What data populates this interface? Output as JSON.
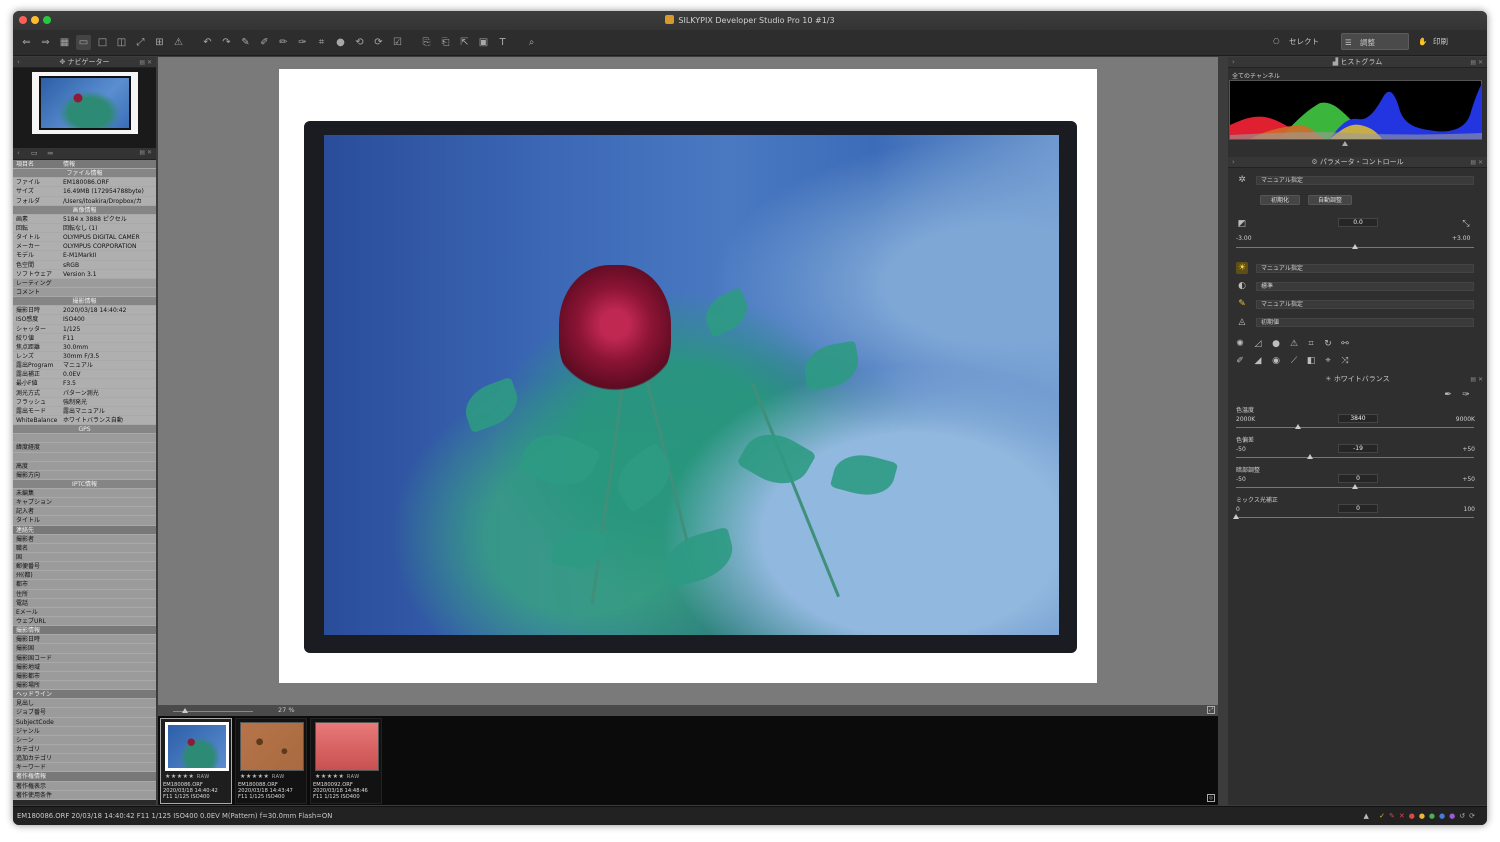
{
  "window": {
    "title": "SILKYPIX Developer Studio Pro 10   #1/3"
  },
  "toolbar": {
    "modes": [
      {
        "label": "セレクト",
        "icon": "select-mode-icon"
      },
      {
        "label": "調整",
        "icon": "adjust-mode-icon",
        "active": true
      },
      {
        "label": "印刷",
        "icon": "print-mode-icon"
      }
    ]
  },
  "navigator": {
    "title": "ナビゲーター"
  },
  "info": {
    "col_key": "項目名",
    "col_val": "情報",
    "rows": [
      {
        "type": "s",
        "k": "",
        "v": "ファイル情報"
      },
      {
        "k": "ファイル",
        "v": "EM180086.ORF"
      },
      {
        "k": "サイズ",
        "v": "16.49MB (172954788byte)"
      },
      {
        "k": "フォルダ",
        "v": "/Users/itoakira/Dropbox/カ"
      },
      {
        "type": "s",
        "k": "",
        "v": "画像情報"
      },
      {
        "k": "画素",
        "v": "5184 x 3888 ピクセル"
      },
      {
        "k": "回転",
        "v": "回転なし (1)"
      },
      {
        "k": "タイトル",
        "v": "OLYMPUS DIGITAL CAMER"
      },
      {
        "k": "メーカー",
        "v": "OLYMPUS CORPORATION"
      },
      {
        "k": "モデル",
        "v": "E-M1MarkII"
      },
      {
        "k": "色空間",
        "v": "sRGB"
      },
      {
        "k": "ソフトウェア",
        "v": "Version 3.1"
      },
      {
        "k": "レーティング",
        "v": ""
      },
      {
        "k": "コメント",
        "v": ""
      },
      {
        "type": "s",
        "k": "",
        "v": "撮影情報"
      },
      {
        "k": "撮影日時",
        "v": "2020/03/18 14:40:42"
      },
      {
        "k": "ISO感度",
        "v": "ISO400"
      },
      {
        "k": "シャッター",
        "v": "1/125"
      },
      {
        "k": "絞り値",
        "v": "F11"
      },
      {
        "k": "焦点距離",
        "v": "30.0mm"
      },
      {
        "k": "レンズ",
        "v": "30mm F/3.5"
      },
      {
        "k": "露出Program",
        "v": "マニュアル"
      },
      {
        "k": "露出補正",
        "v": "0.0EV"
      },
      {
        "k": "最小F値",
        "v": "F3.5"
      },
      {
        "k": "測光方式",
        "v": "パターン測光"
      },
      {
        "k": "フラッシュ",
        "v": "強制発光"
      },
      {
        "k": "露出モード",
        "v": "露出マニュアル"
      },
      {
        "k": "WhiteBalance",
        "v": "ホワイトバランス自動"
      },
      {
        "type": "s",
        "k": "",
        "v": "GPS"
      },
      {
        "k": "",
        "v": ""
      },
      {
        "k": "緯度経度",
        "v": ""
      },
      {
        "k": "",
        "v": ""
      },
      {
        "k": "高度",
        "v": ""
      },
      {
        "k": "撮影方向",
        "v": ""
      },
      {
        "type": "s",
        "k": "",
        "v": "IPTC情報"
      },
      {
        "k": "未編集",
        "v": ""
      },
      {
        "k": "キャプション",
        "v": ""
      },
      {
        "k": "記入者",
        "v": ""
      },
      {
        "k": "タイトル",
        "v": ""
      },
      {
        "type": "h",
        "k": "連絡先",
        "v": ""
      },
      {
        "k": "撮影者",
        "v": ""
      },
      {
        "k": "職名",
        "v": ""
      },
      {
        "k": "国",
        "v": ""
      },
      {
        "k": "郵便番号",
        "v": ""
      },
      {
        "k": "州(都)",
        "v": ""
      },
      {
        "k": "都市",
        "v": ""
      },
      {
        "k": "住所",
        "v": ""
      },
      {
        "k": "電話",
        "v": ""
      },
      {
        "k": "Eメール",
        "v": ""
      },
      {
        "k": "ウェブURL",
        "v": ""
      },
      {
        "type": "h",
        "k": "撮影情報",
        "v": ""
      },
      {
        "k": "撮影日時",
        "v": ""
      },
      {
        "k": "撮影国",
        "v": ""
      },
      {
        "k": "撮影国コード",
        "v": ""
      },
      {
        "k": "撮影地域",
        "v": ""
      },
      {
        "k": "撮影都市",
        "v": ""
      },
      {
        "k": "撮影場所",
        "v": ""
      },
      {
        "type": "h",
        "k": "ヘッドライン",
        "v": ""
      },
      {
        "k": "見出し",
        "v": ""
      },
      {
        "k": "ジョブ番号",
        "v": ""
      },
      {
        "k": "SubjectCode",
        "v": ""
      },
      {
        "k": "ジャンル",
        "v": ""
      },
      {
        "k": "シーン",
        "v": ""
      },
      {
        "k": "カテゴリ",
        "v": ""
      },
      {
        "k": "追加カテゴリ",
        "v": ""
      },
      {
        "k": "キーワード",
        "v": ""
      },
      {
        "type": "h",
        "k": "著作権情報",
        "v": ""
      },
      {
        "k": "著作権表示",
        "v": ""
      },
      {
        "k": "著作使用条件",
        "v": ""
      }
    ]
  },
  "viewer": {
    "zoom": "27 %"
  },
  "filmstrip": [
    {
      "name": "EM180086.ORF",
      "date": "2020/03/18 14:40:42",
      "exif": "F11 1/125 ISO400",
      "stars": "★★★★★",
      "raw": "RAW",
      "selected": true,
      "color": "blue"
    },
    {
      "name": "EM180088.ORF",
      "date": "2020/03/18 14:43:47",
      "exif": "F11 1/125 ISO400",
      "stars": "★★★★★",
      "raw": "RAW",
      "selected": false,
      "color": "brown"
    },
    {
      "name": "EM180092.ORF",
      "date": "2020/03/18 14:48:46",
      "exif": "F11 1/125 ISO400",
      "stars": "★★★★★",
      "raw": "RAW",
      "selected": false,
      "color": "pink"
    }
  ],
  "histogram": {
    "title": "ヒストグラム",
    "channel": "全てのチャンネル"
  },
  "params": {
    "title": "パラメータ・コントロール",
    "preset": "マニュアル指定",
    "init_btn": "初期化",
    "auto_btn": "自動調整",
    "exposure": {
      "value": "0.0",
      "min": "-3.00",
      "max": "+3.00",
      "fraction": 0.5
    },
    "dropdowns": [
      "マニュアル指定",
      "標準",
      "マニュアル指定",
      "初期値"
    ]
  },
  "whitebalance": {
    "title": "ホワイトバランス",
    "sliders": [
      {
        "label": "色温度",
        "value": "3840",
        "min": "2000K",
        "max": "9000K",
        "fraction": 0.26
      },
      {
        "label": "色偏差",
        "value": "-19",
        "min": "-50",
        "max": "+50",
        "fraction": 0.31
      },
      {
        "label": "暗部調整",
        "value": "0",
        "min": "-50",
        "max": "+50",
        "fraction": 0.5
      },
      {
        "label": "ミックス光補正",
        "value": "0",
        "min": "0",
        "max": "100",
        "fraction": 0.0
      }
    ]
  },
  "status": {
    "text": "EM180086.ORF 20/03/18 14:40:42 F11 1/125 ISO400 0.0EV M(Pattern) f=30.0mm Flash=ON"
  },
  "colors": {
    "accent": "#d79a2b",
    "panel": "#2f2f2f",
    "canvas": "#7a7a7a"
  }
}
